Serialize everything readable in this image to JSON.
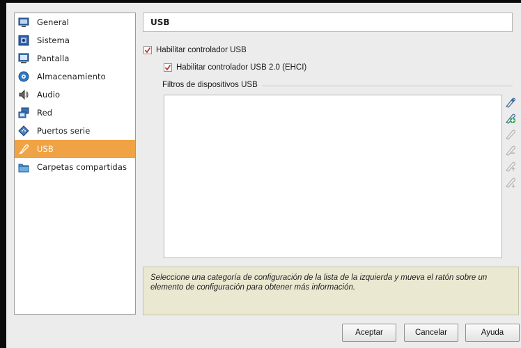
{
  "sidebar": {
    "items": [
      {
        "label": "General",
        "icon": "monitor-icon"
      },
      {
        "label": "Sistema",
        "icon": "chip-icon"
      },
      {
        "label": "Pantalla",
        "icon": "display-icon"
      },
      {
        "label": "Almacenamiento",
        "icon": "disk-icon"
      },
      {
        "label": "Audio",
        "icon": "speaker-icon"
      },
      {
        "label": "Red",
        "icon": "network-icon"
      },
      {
        "label": "Puertos serie",
        "icon": "serial-port-icon"
      },
      {
        "label": "USB",
        "icon": "usb-icon"
      },
      {
        "label": "Carpetas compartidas",
        "icon": "folder-icon"
      }
    ],
    "active_index": 7
  },
  "header": {
    "title": "USB"
  },
  "usb": {
    "enable_controller": {
      "label": "Habilitar controlador USB",
      "checked": true
    },
    "enable_ehci": {
      "label": "Habilitar controlador USB 2.0 (EHCI)",
      "checked": true
    },
    "filters_group_label": "Filtros de dispositivos USB",
    "filter_tools": [
      "add-filter-icon",
      "add-from-device-icon",
      "edit-filter-icon",
      "remove-filter-icon",
      "move-up-icon",
      "move-down-icon"
    ]
  },
  "info": {
    "text": "Seleccione una categoría de configuración de la lista de la izquierda y mueva el ratón sobre un elemento de configuración para obtener más información."
  },
  "footer": {
    "ok_label": "Aceptar",
    "cancel_label": "Cancelar",
    "help_label": "Ayuda"
  },
  "colors": {
    "active_item": "#f0a345",
    "info_background": "#ebe8d2"
  }
}
